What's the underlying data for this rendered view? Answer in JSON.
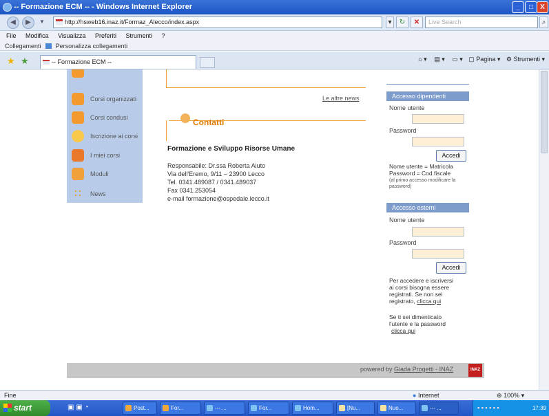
{
  "window": {
    "title": "-- Formazione ECM -- - Windows Internet Explorer",
    "minimize": "_",
    "maximize": "□",
    "close": "X"
  },
  "address_bar": {
    "url": "http://hsweb16.inaz.it/Formaz_Alecco/index.aspx",
    "search_placeholder": "Live Search"
  },
  "menu": {
    "items": [
      "File",
      "Modifica",
      "Visualizza",
      "Preferiti",
      "Strumenti",
      "?"
    ]
  },
  "links_bar": {
    "label": "Collegamenti",
    "item": "Personalizza collegamenti"
  },
  "tab": {
    "title": "-- Formazione ECM --",
    "pagina": "Pagina",
    "strumenti": "Strumenti"
  },
  "sidebar": {
    "items": [
      {
        "label": "Corsi organizzati",
        "icon": "people-icon"
      },
      {
        "label": "Corsi condusi",
        "icon": "people-icon"
      },
      {
        "label": "Iscrizione ai corsi",
        "icon": "smile-icon"
      },
      {
        "label": "I miei corsi",
        "icon": "card-icon"
      },
      {
        "label": "Moduli",
        "icon": "document-icon"
      },
      {
        "label": "News",
        "icon": "rss-icon"
      }
    ]
  },
  "news": {
    "altre_news": "Le altre news"
  },
  "contatti": {
    "title": "Contatti",
    "org": "Formazione e Sviluppo Risorse Umane",
    "lines": [
      "Responsabile: Dr.ssa Roberta Aiuto",
      "Via dell'Eremo, 9/11 – 23900 Lecco",
      "Tel. 0341.489087 / 0341.489037",
      "Fax 0341.253054",
      "e-mail formazione@ospedale.lecco.it"
    ]
  },
  "login_dipendenti": {
    "header": "Accesso dipendenti",
    "username_label": "Nome utente",
    "password_label": "Password",
    "button": "Accedi",
    "hint1": "Nome utente = Matricola",
    "hint2": "Password = Cod.fiscale",
    "hint3": "(al primo accesso modificare la password)"
  },
  "login_esterni": {
    "header": "Accesso esterni",
    "username_label": "Nome utente",
    "password_label": "Password",
    "button": "Accedi",
    "register_text1": "Per accedere e iscriversi",
    "register_text2": "ai corsi bisogna essere",
    "register_text3": "registrati. Se non sei",
    "register_text4": "registrato,",
    "register_link": "clicca qui",
    "forgot_text1": "Se ti sei dimenticato",
    "forgot_text2": "l'utente e la password",
    "forgot_link": "clicca qui"
  },
  "footer": {
    "powered_by": "powered by",
    "powered_link": "Giada Progetti - INAZ",
    "logo_text": "INAZ"
  },
  "status_bar": {
    "left": "Fine",
    "zone": "Internet",
    "zoom": "100%"
  },
  "taskbar": {
    "start": "start",
    "items": [
      "Post...",
      "For...",
      "--- ...",
      "For...",
      "Hom...",
      "[Nu...",
      "Nuo...",
      "--- ..."
    ],
    "time": "17:39"
  }
}
